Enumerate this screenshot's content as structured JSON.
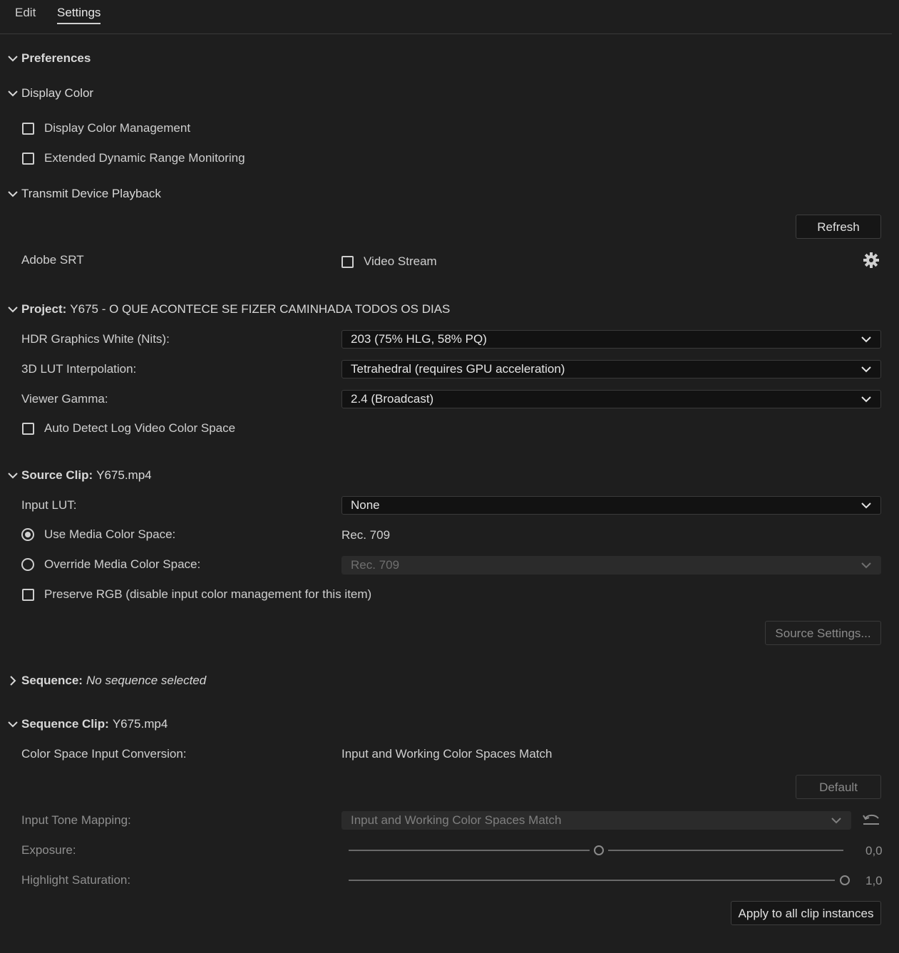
{
  "tabs": {
    "edit": "Edit",
    "settings": "Settings"
  },
  "preferences": {
    "title": "Preferences"
  },
  "display_color": {
    "title": "Display Color",
    "display_color_management": "Display Color Management",
    "extended_dynamic_range": "Extended Dynamic Range Monitoring"
  },
  "transmit": {
    "title": "Transmit Device Playback",
    "refresh": "Refresh",
    "adobe_srt": "Adobe SRT",
    "video_stream": "Video Stream"
  },
  "project": {
    "title_bold": "Project:",
    "title_value": "Y675 - O QUE ACONTECE SE FIZER CAMINHADA TODOS OS DIAS",
    "hdr_label": "HDR Graphics White (Nits):",
    "hdr_value": "203 (75% HLG, 58% PQ)",
    "lut_label": "3D LUT Interpolation:",
    "lut_value": "Tetrahedral (requires GPU acceleration)",
    "gamma_label": "Viewer Gamma:",
    "gamma_value": "2.4 (Broadcast)",
    "auto_detect": "Auto Detect Log Video Color Space"
  },
  "source_clip": {
    "title_bold": "Source Clip:",
    "title_value": "Y675.mp4",
    "input_lut_label": "Input LUT:",
    "input_lut_value": "None",
    "use_media_label": "Use Media Color Space:",
    "use_media_value": "Rec. 709",
    "override_label": "Override Media Color Space:",
    "override_value": "Rec. 709",
    "preserve_rgb": "Preserve RGB (disable input color management for this item)",
    "source_settings": "Source Settings..."
  },
  "sequence": {
    "title_bold": "Sequence:",
    "title_value": "No sequence selected"
  },
  "sequence_clip": {
    "title_bold": "Sequence Clip:",
    "title_value": "Y675.mp4",
    "conversion_label": "Color Space Input Conversion:",
    "conversion_value": "Input and Working Color Spaces Match",
    "default": "Default",
    "tone_label": "Input Tone Mapping:",
    "tone_value": "Input and Working Color Spaces Match",
    "exposure_label": "Exposure:",
    "exposure_value": "0,0",
    "highlight_label": "Highlight Saturation:",
    "highlight_value": "1,0",
    "apply": "Apply to all clip instances"
  },
  "icons": [
    "chevron-down-icon",
    "chevron-right-icon",
    "gear-icon",
    "reset-icon"
  ]
}
